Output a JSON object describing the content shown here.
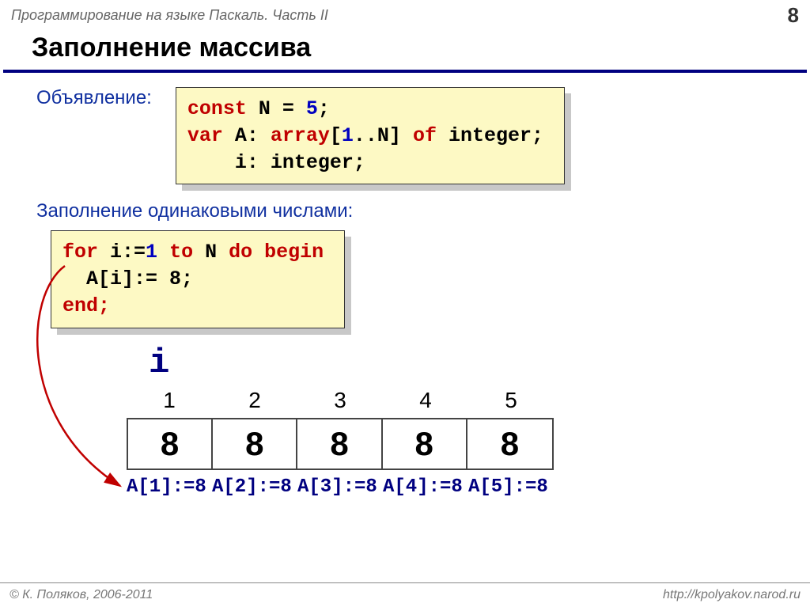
{
  "header": {
    "course": "Программирование на языке Паскаль. Часть II",
    "page": "8"
  },
  "title": "Заполнение массива",
  "section1_label": "Объявление:",
  "code1": {
    "l1a": "const",
    "l1b": " N = ",
    "l1c": "5",
    "l1d": ";",
    "l2a": "var",
    "l2b": " A: ",
    "l2c": "array",
    "l2d": "[",
    "l2e": "1",
    "l2f": "..N] ",
    "l2g": "of",
    "l2h": " integer;",
    "l3": "    i: integer;"
  },
  "section2_label": "Заполнение одинаковыми числами:",
  "code2": {
    "l1a": "for",
    "l1b": " i:=",
    "l1c": "1",
    "l1d": " ",
    "l1e": "to",
    "l1f": " N ",
    "l1g": "do begin",
    "l2": "  A[i]:= 8;",
    "l3": "end;"
  },
  "i_label": "i",
  "array": {
    "indices": [
      "1",
      "2",
      "3",
      "4",
      "5"
    ],
    "values": [
      "8",
      "8",
      "8",
      "8",
      "8"
    ]
  },
  "assignments": [
    "A[1]:=8",
    "A[2]:=8",
    "A[3]:=8",
    "A[4]:=8",
    "A[5]:=8"
  ],
  "footer": {
    "copyright": "© К. Поляков, 2006-2011",
    "url": "http://kpolyakov.narod.ru"
  }
}
